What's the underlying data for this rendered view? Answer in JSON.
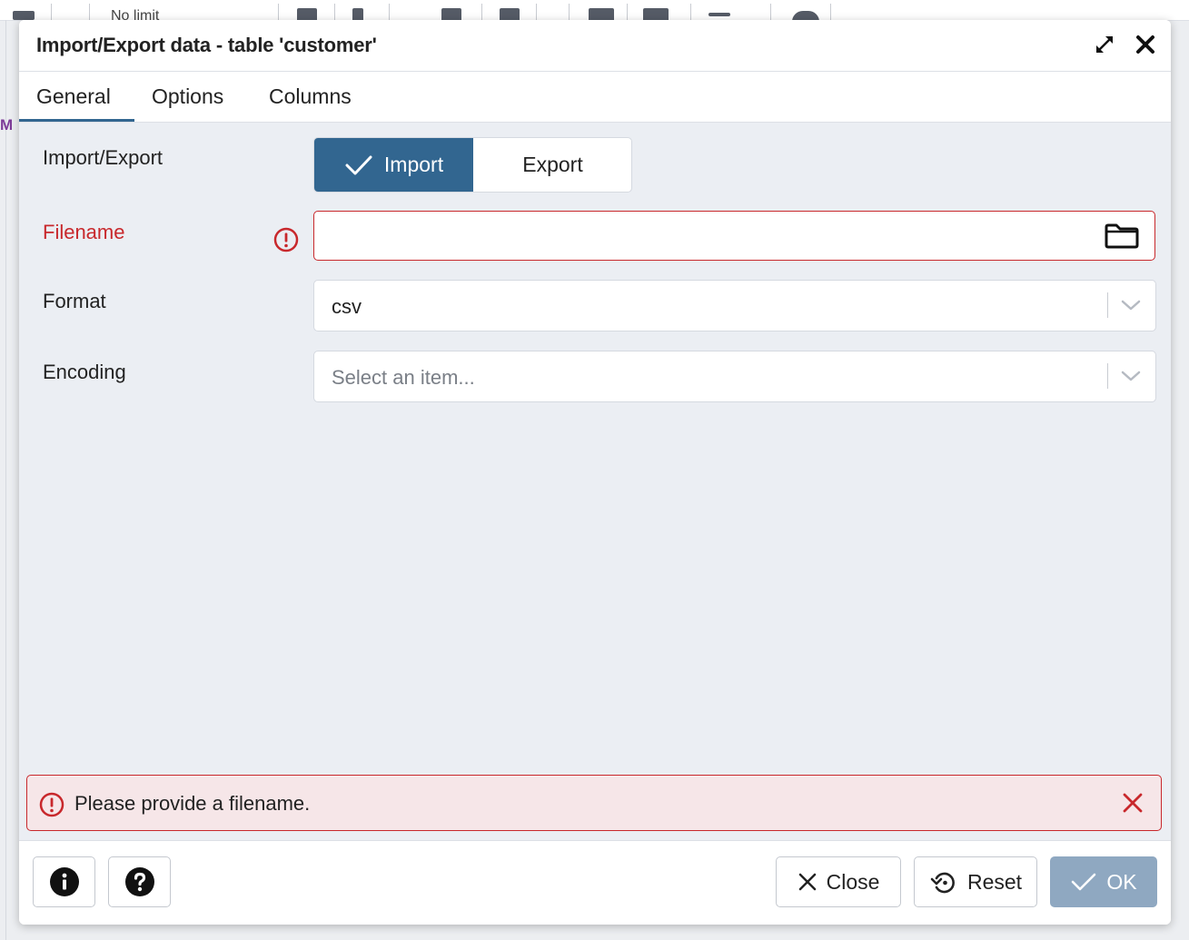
{
  "background": {
    "toolbar_text": "No limit",
    "left_mark": "M"
  },
  "dialog": {
    "title": "Import/Export data - table 'customer'",
    "tabs": [
      "General",
      "Options",
      "Columns"
    ],
    "active_tab": "General"
  },
  "form": {
    "import_export": {
      "label": "Import/Export",
      "options": [
        "Import",
        "Export"
      ],
      "selected": "Import"
    },
    "filename": {
      "label": "Filename",
      "value": "",
      "state": "error"
    },
    "format": {
      "label": "Format",
      "value": "csv"
    },
    "encoding": {
      "label": "Encoding",
      "placeholder": "Select an item..."
    }
  },
  "alert": {
    "message": "Please provide a filename."
  },
  "footer": {
    "close_label": "Close",
    "reset_label": "Reset",
    "ok_label": "OK"
  },
  "colors": {
    "primary": "#326690",
    "error": "#c8282c",
    "ok_disabled": "#8fa8c1",
    "alert_bg": "#f6e6e8",
    "content_bg": "#ebeef3"
  },
  "icons": [
    "expand-icon",
    "close-icon",
    "checkmark-icon",
    "error-icon",
    "folder-icon",
    "chevron-down-icon",
    "info-icon",
    "help-icon",
    "x-icon",
    "reset-icon"
  ]
}
